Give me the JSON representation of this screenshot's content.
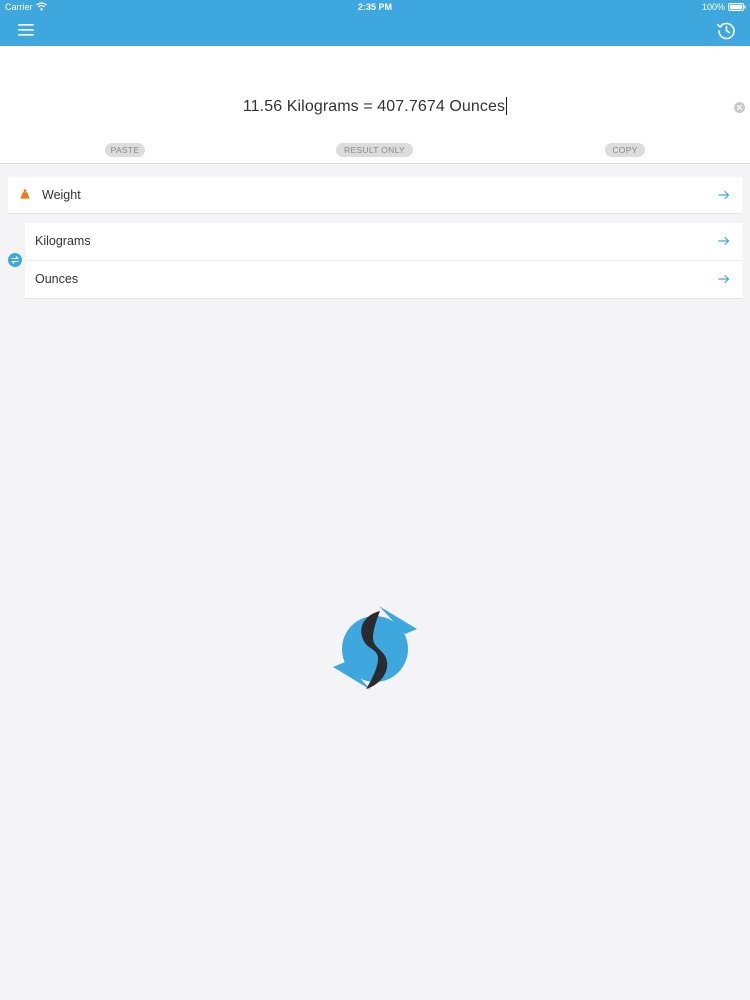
{
  "status_bar": {
    "carrier": "Carrier",
    "time": "2:35 PM",
    "battery": "100%"
  },
  "toolbar": {
    "menu_icon": "hamburger-menu-icon",
    "history_icon": "history-clock-icon"
  },
  "conversion": {
    "expression": "11.56 Kilograms = 407.7674 Ounces"
  },
  "actions": {
    "paste": "PASTE",
    "result_only": "RESULT ONLY",
    "copy": "COPY"
  },
  "category": {
    "label": "Weight",
    "icon": "weight-icon"
  },
  "units": {
    "from": "Kilograms",
    "to": "Ounces"
  },
  "colors": {
    "accent": "#3ea8de",
    "weight_icon": "#f07a1a",
    "logo_dark": "#2b2b2e"
  }
}
